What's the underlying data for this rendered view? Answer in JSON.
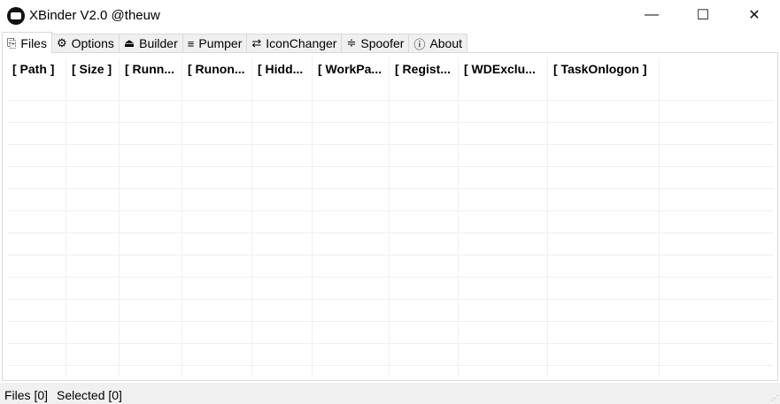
{
  "window": {
    "title": "XBinder V2.0 @theuw",
    "minimize": "—",
    "maximize": "☐",
    "close": "✕"
  },
  "tabs": [
    {
      "label": "Files",
      "icon": "files-icon",
      "glyph": "⎘"
    },
    {
      "label": "Options",
      "icon": "gear-icon",
      "glyph": "⚙"
    },
    {
      "label": "Builder",
      "icon": "builder-icon",
      "glyph": "⏏"
    },
    {
      "label": "Pumper",
      "icon": "pumper-icon",
      "glyph": "≡"
    },
    {
      "label": "IconChanger",
      "icon": "swap-icon",
      "glyph": "⇄"
    },
    {
      "label": "Spoofer",
      "icon": "spoofer-icon",
      "glyph": "≑"
    },
    {
      "label": "About",
      "icon": "info-icon",
      "glyph": "ⓘ"
    }
  ],
  "columns": [
    "[ Path ]",
    "[ Size ]",
    "[ Runn...",
    "[ Runon...",
    "[ Hidd...",
    "[ WorkPa...",
    "[ Regist...",
    "[ WDExclu...",
    "[ TaskOnlogon ]"
  ],
  "status": {
    "files": "Files [0]",
    "selected": "Selected [0]"
  }
}
